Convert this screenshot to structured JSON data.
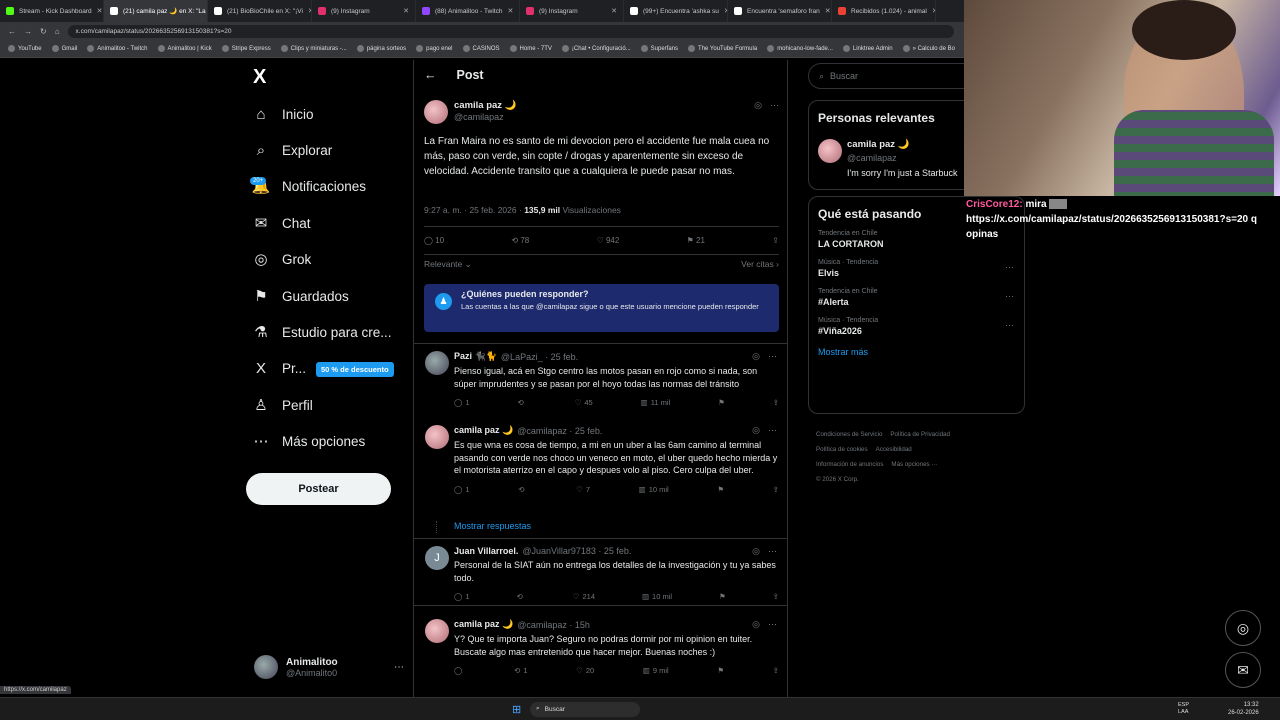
{
  "browser": {
    "tabs": [
      {
        "label": "Stream - Kick Dashboard",
        "color": "#53fc18"
      },
      {
        "label": "(21) camila paz 🌙 en X: \"La F",
        "color": "#ffffff"
      },
      {
        "label": "(21) BioBioChile en X: \"¡Vi",
        "color": "#ffffff"
      },
      {
        "label": "(9) Instagram",
        "color": "#e1306c"
      },
      {
        "label": "(88) Animalitoo - Twitch",
        "color": "#9146ff"
      },
      {
        "label": "(9) Instagram",
        "color": "#e1306c"
      },
      {
        "label": "(99+) Encuentra 'ashka su",
        "color": "#ffffff"
      },
      {
        "label": "Encuentra 'semaforo fran",
        "color": "#ffffff"
      },
      {
        "label": "Recibidos (1.024) - animal",
        "color": "#ea4335"
      }
    ],
    "url": "x.com/camilapaz/status/2026635256913150381?s=20",
    "bookmarks": [
      "YouTube",
      "Gmail",
      "Animalitoo - Twitch",
      "Animalitoo | Kick",
      "Stripe Express",
      "Clips y miniaturas -...",
      "página sorteos",
      "pago enel",
      "CASINOS",
      "Home - 7TV",
      "¡Chat • Configuració...",
      "Superfans",
      "The YouTube Formula",
      "mohicano-low-fade...",
      "Linktree Admin",
      "» Calculo de Bo"
    ],
    "status_url": "https://x.com/camilapaz"
  },
  "nav": {
    "logo": "X",
    "items": [
      {
        "label": "Inicio",
        "icon": "home-icon",
        "glyph": "⌂"
      },
      {
        "label": "Explorar",
        "icon": "search-icon",
        "glyph": "⌕"
      },
      {
        "label": "Notificaciones",
        "icon": "bell-icon",
        "glyph": "🔔"
      },
      {
        "label": "Chat",
        "icon": "mail-icon",
        "glyph": "✉"
      },
      {
        "label": "Grok",
        "icon": "grok-icon",
        "glyph": "◎"
      },
      {
        "label": "Guardados",
        "icon": "bookmark-icon",
        "glyph": "⚑"
      },
      {
        "label": "Estudio para cre...",
        "icon": "studio-icon",
        "glyph": "⚗"
      },
      {
        "label": "Pr...",
        "icon": "x-premium-icon",
        "glyph": "X"
      },
      {
        "label": "Perfil",
        "icon": "profile-icon",
        "glyph": "♙"
      },
      {
        "label": "Más opciones",
        "icon": "more-icon",
        "glyph": "⋯"
      }
    ],
    "notif_badge": "20+",
    "premium_promo": "50 % de descuento",
    "post_button": "Postear",
    "account": {
      "name": "Animalitoo",
      "handle": "@Animalito0"
    }
  },
  "post": {
    "header": "Post",
    "author": "camila paz 🌙",
    "handle": "@camilapaz",
    "text": "La Fran Maira no es santo de mi devocion pero el accidente fue mala cuea no más, paso con verde, sin copte / drogas y aparentemente sin exceso de velocidad. Accidente transito que a cualquiera le puede pasar no mas.",
    "meta_time": "9:27 a. m. · 25 feb. 2026 ·",
    "views": "135,9 mil",
    "views_label": "Visualizaciones",
    "stats": {
      "replies": "10",
      "reposts": "78",
      "likes": "942",
      "bookmarks": "21"
    },
    "sort_label": "Relevante",
    "quotes_label": "Ver citas",
    "who_can_reply_title": "¿Quiénes pueden responder?",
    "who_can_reply_text": "Las cuentas a las que @camilapaz sigue o que este usuario mencione pueden responder"
  },
  "replies": [
    {
      "name": "Pazi 🐈‍⬛🐈",
      "handle": "@LaPazi_ · 25 feb.",
      "text": "Pienso igual, acá en Stgo centro las motos pasan en rojo como si nada, son súper imprudentes y se pasan por el hoyo todas las normas del tránsito",
      "replies": "1",
      "reposts": "",
      "likes": "45",
      "views": "11 mil"
    },
    {
      "name": "camila paz 🌙",
      "handle": "@camilapaz · 25 feb.",
      "text": "Es que wna es cosa de tiempo, a mi en un uber a las 6am camino al terminal pasando con verde nos choco un veneco en moto, el uber quedo hecho mierda y el motorista aterrizo en el capo y despues volo al piso. Cero culpa del uber.",
      "replies": "1",
      "reposts": "",
      "likes": "7",
      "views": "10 mil"
    },
    {
      "name": "Juan Villarroel.",
      "handle": "@JuanVillar97183 · 25 feb.",
      "text": "Personal de la SIAT aún no entrega los detalles de la investigación y tu ya sabes todo.",
      "replies": "1",
      "reposts": "",
      "likes": "214",
      "views": "10 mil"
    },
    {
      "name": "camila paz 🌙",
      "handle": "@camilapaz · 15h",
      "text": "Y? Que te importa Juan? Seguro no podras dormir por mi opinion en tuiter. Buscate algo mas entretenido que hacer mejor. Buenas noches :)",
      "replies": "",
      "reposts": "1",
      "likes": "20",
      "views": "9 mil"
    }
  ],
  "show_replies": "Mostrar respuestas",
  "right": {
    "search_placeholder": "Buscar",
    "relevant_title": "Personas relevantes",
    "relevant_name": "camila paz 🌙",
    "relevant_handle": "@camilapaz",
    "relevant_bio": "I'm sorry I'm just a Starbuck",
    "trends_title": "Qué está pasando",
    "trends": [
      {
        "cat": "Tendencia en Chile",
        "name": "LA CORTARON"
      },
      {
        "cat": "Música · Tendencia",
        "name": "Elvis"
      },
      {
        "cat": "Tendencia en Chile",
        "name": "#Alerta"
      },
      {
        "cat": "Música · Tendencia",
        "name": "#Viña2026"
      }
    ],
    "show_more": "Mostrar más",
    "footer": [
      "Condiciones de Servicio",
      "Política de Privacidad",
      "Política de cookies",
      "Accesibilidad",
      "Información de anuncios",
      "Más opciones ···",
      "© 2026 X Corp."
    ]
  },
  "stream_chat": {
    "user": "CrisCore12:",
    "message": "mira",
    "link": "https://x.com/camilapaz/status/2026635256913150381?s=20 q opinas"
  },
  "taskbar": {
    "search": "Buscar",
    "lang": "ESP LAA",
    "time": "13:32",
    "date": "26-02-2026"
  },
  "colors": {
    "accent": "#1d9bf0",
    "bg": "#000000",
    "muted": "#71767b",
    "border": "#2f3336"
  }
}
